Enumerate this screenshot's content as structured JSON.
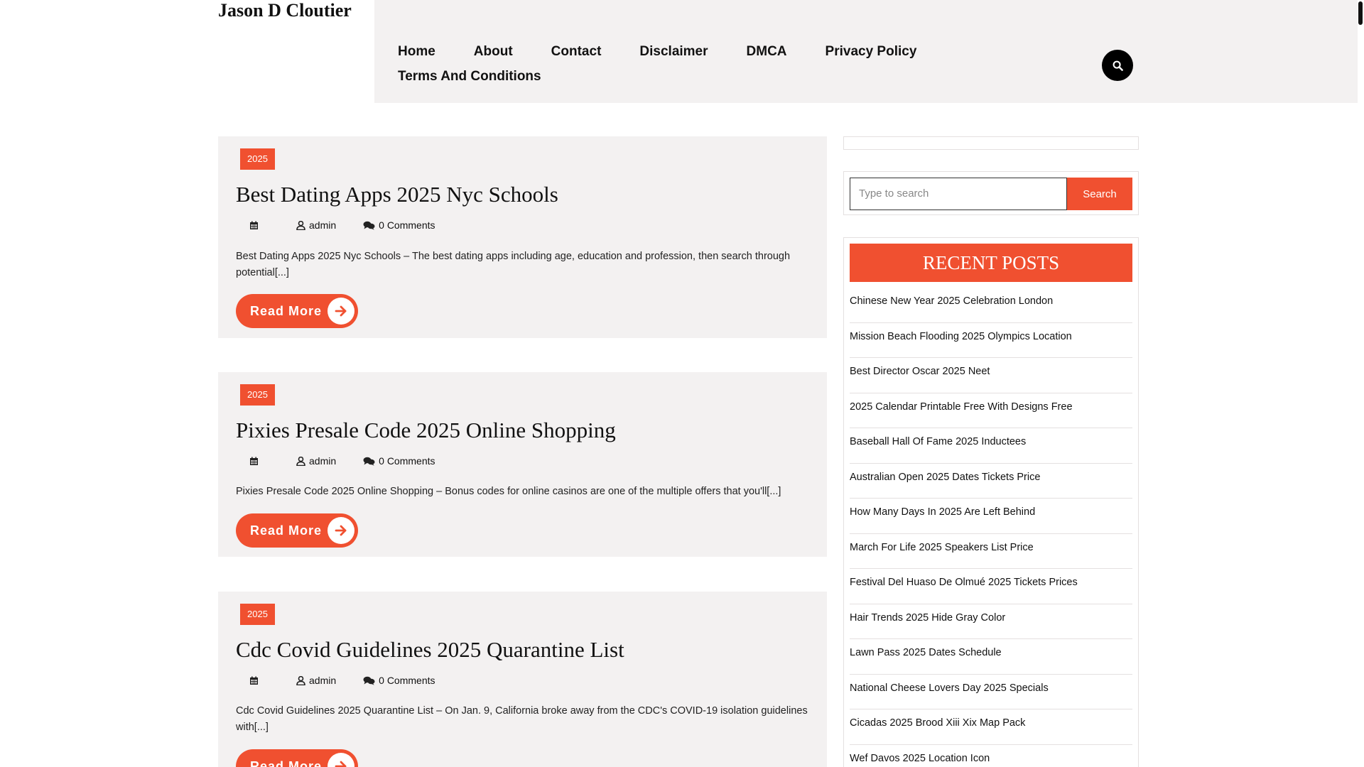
{
  "site": {
    "title": "Jason D Cloutier"
  },
  "nav": {
    "row1": [
      "Home",
      "About",
      "Contact",
      "Disclaimer",
      "DMCA",
      "Privacy Policy"
    ],
    "row2": [
      "Terms And Conditions"
    ]
  },
  "posts": [
    {
      "category": "2025",
      "title": "Best Dating Apps 2025 Nyc Schools",
      "author": "admin",
      "comments": "0 Comments",
      "excerpt": "Best Dating Apps 2025 Nyc Schools – The best dating apps including age, education and profession, then search through potential[...]",
      "read_more": "Read More"
    },
    {
      "category": "2025",
      "title": "Pixies Presale Code 2025 Online Shopping",
      "author": "admin",
      "comments": "0 Comments",
      "excerpt": "Pixies Presale Code 2025 Online Shopping – Bonus codes for online casinos are one of the multiple offers that you'll[...]",
      "read_more": "Read More"
    },
    {
      "category": "2025",
      "title": "Cdc Covid Guidelines 2025 Quarantine List",
      "author": "admin",
      "comments": "0 Comments",
      "excerpt": "Cdc Covid Guidelines 2025 Quarantine List – On Jan. 9, California broke away from the CDC's COVID-19 isolation guidelines with[...]",
      "read_more": "Read More"
    }
  ],
  "sidebar": {
    "search_placeholder": "Type to search",
    "search_button": "Search",
    "recent_title": "RECENT POSTS",
    "recent_posts": [
      "Chinese New Year 2025 Celebration London",
      "Mission Beach Flooding 2025 Olympics Location",
      "Best Director Oscar 2025 Neet",
      "2025 Calendar Printable Free With Designs Free",
      "Baseball Hall Of Fame 2025 Inductees",
      "Australian Open 2025 Dates Tickets Price",
      "How Many Days In 2025 Are Left Behind",
      "March For Life 2025 Speakers List Price",
      "Festival Del Huaso De Olmué 2025 Tickets Prices",
      "Hair Trends 2025 Hide Gray Color",
      "Lawn Pass 2025 Dates Schedule",
      "National Cheese Lovers Day 2025 Specials",
      "Cicadas 2025 Brood Xiii Xix Map Pack",
      "Wef Davos 2025 Location Icon"
    ]
  },
  "colors": {
    "accent": "#f05030",
    "panel": "#f3f1f1"
  },
  "icons": [
    "search-icon",
    "calendar-icon",
    "user-icon",
    "comments-icon",
    "arrow-right-icon"
  ]
}
